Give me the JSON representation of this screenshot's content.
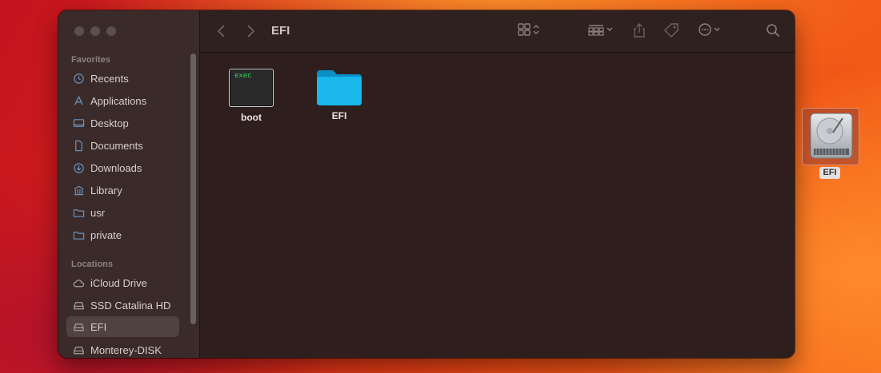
{
  "window": {
    "title": "EFI"
  },
  "sidebar": {
    "favorites_heading": "Favorites",
    "favorites": [
      {
        "label": "Recents",
        "icon": "clock-icon"
      },
      {
        "label": "Applications",
        "icon": "applications-icon"
      },
      {
        "label": "Desktop",
        "icon": "desktop-icon"
      },
      {
        "label": "Documents",
        "icon": "document-icon"
      },
      {
        "label": "Downloads",
        "icon": "download-icon"
      },
      {
        "label": "Library",
        "icon": "library-icon"
      },
      {
        "label": "usr",
        "icon": "folder-icon"
      },
      {
        "label": "private",
        "icon": "folder-icon"
      }
    ],
    "locations_heading": "Locations",
    "locations": [
      {
        "label": "iCloud Drive",
        "icon": "cloud-icon"
      },
      {
        "label": "SSD Catalina HD",
        "icon": "drive-icon"
      },
      {
        "label": "EFI",
        "icon": "drive-icon",
        "selected": true
      },
      {
        "label": "Monterey-DISK",
        "icon": "drive-icon"
      }
    ]
  },
  "files": [
    {
      "name": "boot",
      "icon": "exec-icon",
      "icon_text": "exec"
    },
    {
      "name": "EFI",
      "icon": "folder-icon"
    }
  ],
  "desktop": {
    "drive_label": "EFI"
  },
  "colors": {
    "folder": "#19b7ea",
    "selection": "#4f4241",
    "exec_text": "#36d35a"
  }
}
